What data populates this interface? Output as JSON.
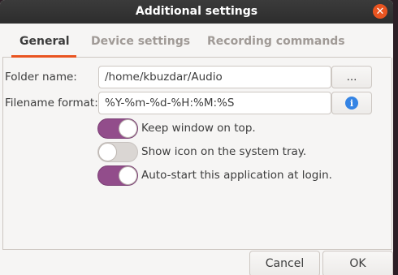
{
  "window": {
    "title": "Additional settings"
  },
  "tabs": [
    {
      "label": "General",
      "active": true
    },
    {
      "label": "Device settings",
      "active": false
    },
    {
      "label": "Recording commands",
      "active": false
    }
  ],
  "general": {
    "folder_label": "Folder name:",
    "folder_value": "/home/kbuzdar/Audio",
    "browse_label": "...",
    "filename_label": "Filename format:",
    "filename_value": "%Y-%m-%d-%H:%M:%S",
    "info_icon": "i",
    "options": [
      {
        "label": "Keep window on top.",
        "on": true
      },
      {
        "label": "Show icon on the system tray.",
        "on": false
      },
      {
        "label": "Auto-start this application at login.",
        "on": true
      }
    ]
  },
  "footer": {
    "cancel_label": "Cancel",
    "ok_label": "OK"
  },
  "colors": {
    "accent": "#e95420",
    "switch_on": "#924d8b",
    "info": "#3584e4"
  }
}
